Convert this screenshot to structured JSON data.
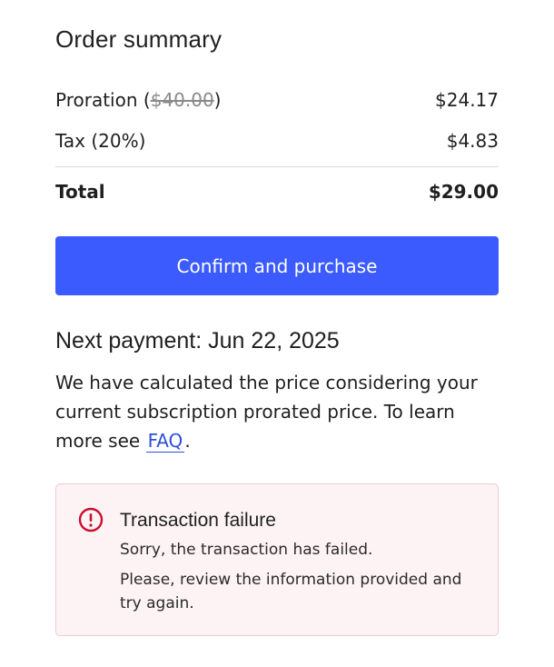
{
  "summary": {
    "title": "Order summary",
    "proration_label": "Proration (",
    "proration_original": "$40.00",
    "proration_close": ")",
    "proration_value": "$24.17",
    "tax_label": "Tax (20%)",
    "tax_value": "$4.83",
    "total_label": "Total",
    "total_value": "$29.00"
  },
  "actions": {
    "confirm_label": "Confirm and purchase"
  },
  "next_payment": {
    "heading": "Next payment: Jun 22, 2025",
    "text": "We have calculated the price considering your current subscription prorated price. To learn more see ",
    "faq_link": "FAQ",
    "text_end": "."
  },
  "alert": {
    "icon": "error-circle-icon",
    "title": "Transaction failure",
    "line1": "Sorry, the transaction has failed.",
    "line2": "Please, review the information provided and try again."
  },
  "colors": {
    "primary_button": "#3b5bff",
    "link": "#2f4fd8",
    "alert_background": "#fdf3f4",
    "alert_border": "#f3c9cf",
    "alert_icon": "#c8102e"
  }
}
